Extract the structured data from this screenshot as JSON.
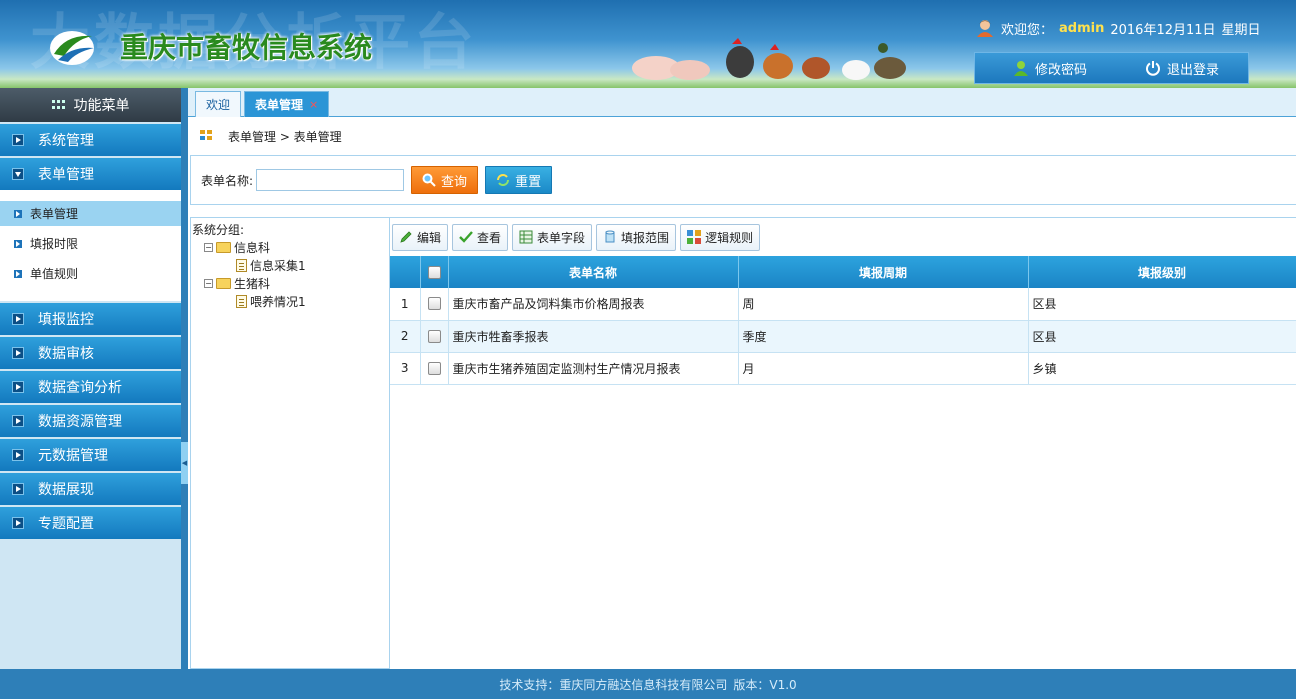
{
  "header": {
    "bg_text": "大数据分析平台",
    "system_title": "重庆市畜牧信息系统",
    "welcome_label": "欢迎您：",
    "username": "admin",
    "date": "2016年12月11日",
    "weekday": "星期日",
    "change_password": "修改密码",
    "logout": "退出登录"
  },
  "sidebar": {
    "title": "功能菜单",
    "menu": [
      {
        "label": "系统管理"
      },
      {
        "label": "表单管理"
      },
      {
        "label": "填报监控"
      },
      {
        "label": "数据审核"
      },
      {
        "label": "数据查询分析"
      },
      {
        "label": "数据资源管理"
      },
      {
        "label": "元数据管理"
      },
      {
        "label": "数据展现"
      },
      {
        "label": "专题配置"
      }
    ],
    "submenu": [
      {
        "label": "表单管理"
      },
      {
        "label": "填报时限"
      },
      {
        "label": "单值规则"
      }
    ]
  },
  "tabs": {
    "welcome": "欢迎",
    "active": "表单管理",
    "close": "×"
  },
  "breadcrumb": {
    "text": "表单管理 > 表单管理"
  },
  "search": {
    "label": "表单名称:",
    "value": "",
    "query_button": "查询",
    "reset_button": "重置"
  },
  "tree": {
    "title": "系统分组:",
    "groups": [
      {
        "label": "信息科",
        "children": [
          "信息采集1"
        ]
      },
      {
        "label": "生猪科",
        "children": [
          "喂养情况1"
        ]
      }
    ]
  },
  "toolbar": {
    "edit": "编辑",
    "view": "查看",
    "fields": "表单字段",
    "scope": "填报范围",
    "logic": "逻辑规则"
  },
  "table": {
    "headers": {
      "name": "表单名称",
      "period": "填报周期",
      "level": "填报级别"
    },
    "rows": [
      {
        "num": "1",
        "name": "重庆市畜产品及饲料集市价格周报表",
        "period": "周",
        "level": "区县"
      },
      {
        "num": "2",
        "name": "重庆市牲畜季报表",
        "period": "季度",
        "level": "区县"
      },
      {
        "num": "3",
        "name": "重庆市生猪养殖固定监测村生产情况月报表",
        "period": "月",
        "level": "乡镇"
      }
    ]
  },
  "footer": {
    "support": "技术支持：重庆同方融达信息科技有限公司",
    "version": "版本：V1.0"
  },
  "colors": {
    "accent": "#1b89c7",
    "header_blue": "#2e7fb8",
    "orange": "#ee6f0c",
    "username": "#ffe14d"
  }
}
